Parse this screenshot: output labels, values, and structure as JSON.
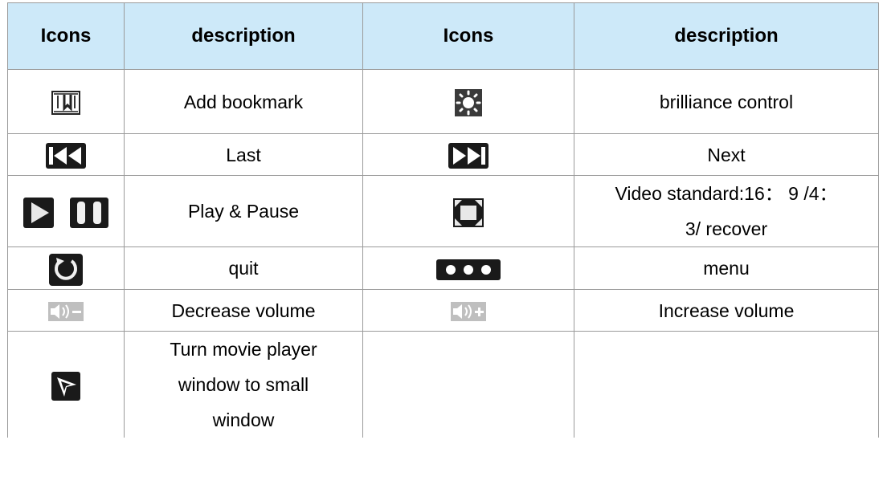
{
  "headers": [
    "Icons",
    "description",
    "Icons",
    "description"
  ],
  "rows": [
    {
      "left_icon": "bookmark-icon",
      "left_desc": "Add bookmark",
      "right_icon": "brightness-icon",
      "right_desc": "brilliance control"
    },
    {
      "left_icon": "previous-track-icon",
      "left_desc": "Last",
      "right_icon": "next-track-icon",
      "right_desc": "Next"
    },
    {
      "left_icon": "play-pause-icon",
      "left_desc": "Play & Pause",
      "right_icon": "aspect-ratio-icon",
      "right_desc_lines": [
        "Video standard:16： 9 /4：",
        "3/ recover"
      ]
    },
    {
      "left_icon": "quit-icon",
      "left_desc": "quit",
      "right_icon": "menu-dots-icon",
      "right_desc": "menu"
    },
    {
      "left_icon": "volume-down-icon",
      "left_desc": "Decrease volume",
      "right_icon": "volume-up-icon",
      "right_desc": "Increase volume"
    },
    {
      "left_icon": "small-window-icon",
      "left_desc_lines": [
        "Turn movie player",
        "window to small",
        "window"
      ],
      "right_icon": "",
      "right_desc": ""
    }
  ]
}
